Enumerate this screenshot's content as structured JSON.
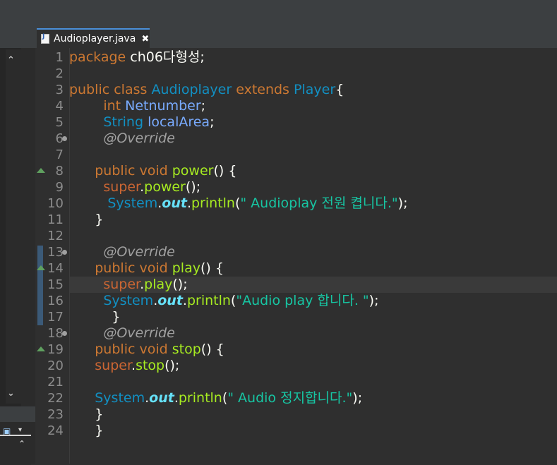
{
  "tab": {
    "title": "Audioplayer.java",
    "close": "✖"
  },
  "left_panel": {
    "scroll_up": "⌃",
    "scroll_down": "⌄",
    "toolbar_dropdown": "▾"
  },
  "lines": [
    {
      "n": "1",
      "tokens": [
        [
          "kw",
          "package"
        ],
        [
          "plain",
          " ch06다형성;"
        ]
      ]
    },
    {
      "n": "2",
      "tokens": []
    },
    {
      "n": "3",
      "tokens": [
        [
          "kw",
          "public"
        ],
        [
          "plain",
          " "
        ],
        [
          "kw",
          "class"
        ],
        [
          "plain",
          " "
        ],
        [
          "cls",
          "Audioplayer"
        ],
        [
          "plain",
          " "
        ],
        [
          "kw",
          "extends"
        ],
        [
          "plain",
          " "
        ],
        [
          "cls",
          "Player"
        ],
        [
          "plain",
          "{"
        ]
      ]
    },
    {
      "n": "4",
      "tokens": [
        [
          "plain",
          "        "
        ],
        [
          "type",
          "int"
        ],
        [
          "plain",
          " "
        ],
        [
          "id",
          "Netnumber"
        ],
        [
          "plain",
          ";"
        ]
      ]
    },
    {
      "n": "5",
      "tokens": [
        [
          "plain",
          "        "
        ],
        [
          "cls",
          "String"
        ],
        [
          "plain",
          " "
        ],
        [
          "id",
          "localArea"
        ],
        [
          "plain",
          ";"
        ]
      ]
    },
    {
      "n": "6",
      "tokens": [
        [
          "plain",
          "        "
        ],
        [
          "ann",
          "@Override"
        ]
      ]
    },
    {
      "n": "7",
      "tokens": []
    },
    {
      "n": "8",
      "tokens": [
        [
          "plain",
          "      "
        ],
        [
          "kw",
          "public"
        ],
        [
          "plain",
          " "
        ],
        [
          "kw",
          "void"
        ],
        [
          "plain",
          " "
        ],
        [
          "fn",
          "power"
        ],
        [
          "plain",
          "() {"
        ]
      ]
    },
    {
      "n": "9",
      "tokens": [
        [
          "plain",
          "        "
        ],
        [
          "sup",
          "super"
        ],
        [
          "plain",
          "."
        ],
        [
          "fn",
          "power"
        ],
        [
          "plain",
          "();"
        ]
      ]
    },
    {
      "n": "10",
      "tokens": [
        [
          "plain",
          "         "
        ],
        [
          "sys",
          "System"
        ],
        [
          "plain",
          "."
        ],
        [
          "fld",
          "out"
        ],
        [
          "plain",
          "."
        ],
        [
          "fn",
          "println"
        ],
        [
          "plain",
          "("
        ],
        [
          "str",
          "\" Audioplay 전원 켭니다.\""
        ],
        [
          "plain",
          ");"
        ]
      ]
    },
    {
      "n": "11",
      "tokens": [
        [
          "plain",
          "      }"
        ]
      ]
    },
    {
      "n": "12",
      "tokens": []
    },
    {
      "n": "13",
      "tokens": [
        [
          "plain",
          "        "
        ],
        [
          "ann",
          "@Override"
        ]
      ]
    },
    {
      "n": "14",
      "tokens": [
        [
          "plain",
          "      "
        ],
        [
          "kw",
          "public"
        ],
        [
          "plain",
          " "
        ],
        [
          "kw",
          "void"
        ],
        [
          "plain",
          " "
        ],
        [
          "fn",
          "play"
        ],
        [
          "plain",
          "() {"
        ]
      ]
    },
    {
      "n": "15",
      "tokens": [
        [
          "plain",
          "        "
        ],
        [
          "sup",
          "super"
        ],
        [
          "plain",
          "."
        ],
        [
          "fn",
          "play"
        ],
        [
          "plain",
          "();"
        ]
      ]
    },
    {
      "n": "16",
      "tokens": [
        [
          "plain",
          "        "
        ],
        [
          "sys",
          "System"
        ],
        [
          "plain",
          "."
        ],
        [
          "fld",
          "out"
        ],
        [
          "plain",
          "."
        ],
        [
          "fn",
          "println"
        ],
        [
          "plain",
          "("
        ],
        [
          "str",
          "\"Audio play 합니다. \""
        ],
        [
          "plain",
          ");"
        ]
      ]
    },
    {
      "n": "17",
      "tokens": [
        [
          "plain",
          "          }"
        ]
      ]
    },
    {
      "n": "18",
      "tokens": [
        [
          "plain",
          "        "
        ],
        [
          "ann",
          "@Override"
        ]
      ]
    },
    {
      "n": "19",
      "tokens": [
        [
          "plain",
          "      "
        ],
        [
          "kw",
          "public"
        ],
        [
          "plain",
          " "
        ],
        [
          "kw",
          "void"
        ],
        [
          "plain",
          " "
        ],
        [
          "fn",
          "stop"
        ],
        [
          "plain",
          "() {"
        ]
      ]
    },
    {
      "n": "20",
      "tokens": [
        [
          "plain",
          "      "
        ],
        [
          "sup",
          "super"
        ],
        [
          "plain",
          "."
        ],
        [
          "fn",
          "stop"
        ],
        [
          "plain",
          "();"
        ]
      ]
    },
    {
      "n": "21",
      "tokens": []
    },
    {
      "n": "22",
      "tokens": [
        [
          "plain",
          "      "
        ],
        [
          "sys",
          "System"
        ],
        [
          "plain",
          "."
        ],
        [
          "fld",
          "out"
        ],
        [
          "plain",
          "."
        ],
        [
          "fn",
          "println"
        ],
        [
          "plain",
          "("
        ],
        [
          "str",
          "\" Audio 정지합니다.\""
        ],
        [
          "plain",
          ");"
        ]
      ]
    },
    {
      "n": "23",
      "tokens": [
        [
          "plain",
          "      }"
        ]
      ]
    },
    {
      "n": "24",
      "tokens": [
        [
          "plain",
          "      }"
        ]
      ]
    }
  ],
  "colors": {
    "keyword": "#cc7832",
    "class": "#1290c3",
    "string": "#17c6a3",
    "method": "#a7ec21",
    "annotation": "#a0a0a0"
  }
}
